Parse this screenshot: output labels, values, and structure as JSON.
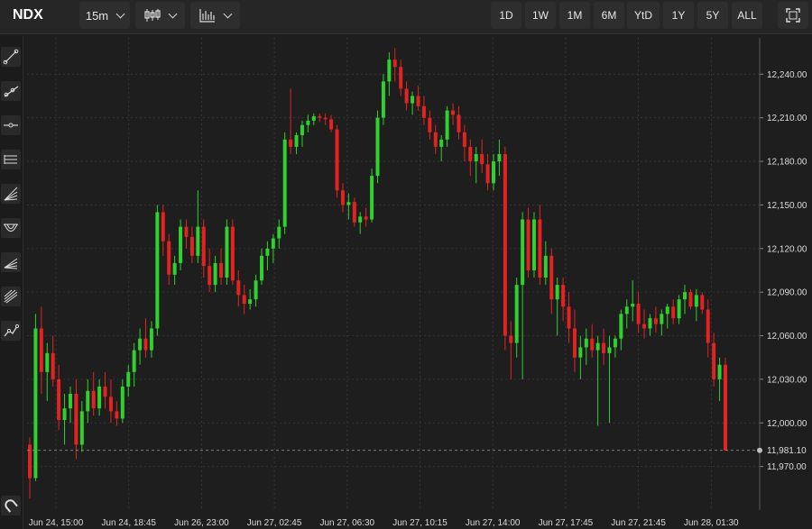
{
  "toolbar": {
    "symbol": "NDX",
    "interval": "15m",
    "chart_type_icon": "candlestick-icon",
    "indicators_icon": "bar-volume-icon",
    "ranges": [
      "1D",
      "1W",
      "1M",
      "6M",
      "YtD",
      "1Y",
      "5Y",
      "ALL"
    ],
    "fullscreen_icon": "fullscreen-icon"
  },
  "left_tools": [
    "trendline-icon",
    "ray-icon",
    "horizontal-line-icon",
    "parallel-channel-icon",
    "fib-fan-icon",
    "fib-arc-icon",
    "pitchfork-icon",
    "gann-icon",
    "path-icon",
    "magnet-icon"
  ],
  "colors": {
    "up": "#2fd12f",
    "down": "#e52222",
    "background": "#1e1e1e",
    "grid": "#3a3a3a"
  },
  "chart_data": {
    "type": "candlestick",
    "symbol": "NDX",
    "interval": "15m",
    "ylim": [
      11940,
      12265
    ],
    "y_ticks": [
      "12,240.00",
      "12,210.00",
      "12,180.00",
      "12,150.00",
      "12,120.00",
      "12,090.00",
      "12,060.00",
      "12,030.00",
      "12,000.00",
      "11,970.00"
    ],
    "y_tick_values": [
      12240,
      12210,
      12180,
      12150,
      12120,
      12090,
      12060,
      12030,
      12000,
      11970
    ],
    "x_ticks": [
      "Jun 24, 15:00",
      "Jun 24, 18:45",
      "Jun 26, 23:00",
      "Jun 27, 02:45",
      "Jun 27, 06:30",
      "Jun 27, 10:15",
      "Jun 27, 14:00",
      "Jun 27, 17:45",
      "Jun 27, 21:45",
      "Jun 28, 01:30"
    ],
    "last_price_label": "11,981.10",
    "last_price": 11981.1,
    "ohlc_note": "approximate per-candle values read from the chart",
    "candles": [
      [
        11985,
        11990,
        11948,
        11962
      ],
      [
        11962,
        12075,
        11960,
        12065
      ],
      [
        12065,
        12080,
        12020,
        12035
      ],
      [
        12035,
        12055,
        12015,
        12048
      ],
      [
        12048,
        12060,
        12025,
        12030
      ],
      [
        12030,
        12040,
        11995,
        12002
      ],
      [
        12002,
        12020,
        11985,
        12010
      ],
      [
        12010,
        12025,
        12000,
        12020
      ],
      [
        12020,
        12030,
        11975,
        11985
      ],
      [
        11985,
        12015,
        11980,
        12008
      ],
      [
        12008,
        12030,
        12000,
        12022
      ],
      [
        12022,
        12035,
        12005,
        12010
      ],
      [
        12010,
        12030,
        12005,
        12025
      ],
      [
        12025,
        12035,
        12010,
        12018
      ],
      [
        12018,
        12030,
        12000,
        12008
      ],
      [
        12008,
        12015,
        11998,
        12003
      ],
      [
        12003,
        12030,
        12000,
        12025
      ],
      [
        12025,
        12040,
        12018,
        12035
      ],
      [
        12035,
        12055,
        12025,
        12050
      ],
      [
        12050,
        12065,
        12040,
        12058
      ],
      [
        12058,
        12072,
        12045,
        12050
      ],
      [
        12050,
        12070,
        12045,
        12065
      ],
      [
        12065,
        12150,
        12060,
        12145
      ],
      [
        12145,
        12150,
        12115,
        12125
      ],
      [
        12125,
        12130,
        12095,
        12102
      ],
      [
        12102,
        12115,
        12095,
        12110
      ],
      [
        12110,
        12140,
        12105,
        12135
      ],
      [
        12135,
        12140,
        12120,
        12128
      ],
      [
        12128,
        12135,
        12110,
        12115
      ],
      [
        12115,
        12160,
        12110,
        12135
      ],
      [
        12135,
        12140,
        12100,
        12108
      ],
      [
        12108,
        12120,
        12090,
        12095
      ],
      [
        12095,
        12115,
        12090,
        12110
      ],
      [
        12110,
        12120,
        12095,
        12100
      ],
      [
        12100,
        12140,
        12095,
        12135
      ],
      [
        12135,
        12140,
        12095,
        12098
      ],
      [
        12098,
        12105,
        12080,
        12088
      ],
      [
        12088,
        12095,
        12075,
        12082
      ],
      [
        12082,
        12092,
        12078,
        12085
      ],
      [
        12085,
        12102,
        12080,
        12098
      ],
      [
        12098,
        12120,
        12095,
        12115
      ],
      [
        12115,
        12125,
        12105,
        12120
      ],
      [
        12120,
        12130,
        12110,
        12127
      ],
      [
        12127,
        12140,
        12120,
        12135
      ],
      [
        12135,
        12200,
        12130,
        12195
      ],
      [
        12195,
        12230,
        12185,
        12190
      ],
      [
        12190,
        12200,
        12185,
        12198
      ],
      [
        12198,
        12208,
        12190,
        12205
      ],
      [
        12205,
        12212,
        12200,
        12208
      ],
      [
        12208,
        12213,
        12205,
        12211
      ],
      [
        12211,
        12213,
        12207,
        12210
      ],
      [
        12210,
        12213,
        12205,
        12209
      ],
      [
        12209,
        12212,
        12200,
        12202
      ],
      [
        12202,
        12205,
        12155,
        12160
      ],
      [
        12160,
        12165,
        12145,
        12150
      ],
      [
        12150,
        12158,
        12140,
        12152
      ],
      [
        12152,
        12155,
        12135,
        12138
      ],
      [
        12138,
        12145,
        12130,
        12142
      ],
      [
        12142,
        12148,
        12135,
        12140
      ],
      [
        12140,
        12175,
        12138,
        12170
      ],
      [
        12170,
        12215,
        12165,
        12210
      ],
      [
        12210,
        12240,
        12205,
        12235
      ],
      [
        12235,
        12255,
        12225,
        12250
      ],
      [
        12250,
        12258,
        12235,
        12245
      ],
      [
        12245,
        12250,
        12225,
        12230
      ],
      [
        12230,
        12235,
        12215,
        12220
      ],
      [
        12220,
        12228,
        12212,
        12225
      ],
      [
        12225,
        12232,
        12215,
        12218
      ],
      [
        12218,
        12225,
        12205,
        12210
      ],
      [
        12210,
        12215,
        12195,
        12200
      ],
      [
        12200,
        12205,
        12185,
        12190
      ],
      [
        12190,
        12198,
        12180,
        12195
      ],
      [
        12195,
        12218,
        12190,
        12215
      ],
      [
        12215,
        12220,
        12205,
        12212
      ],
      [
        12212,
        12218,
        12195,
        12200
      ],
      [
        12200,
        12205,
        12180,
        12190
      ],
      [
        12190,
        12195,
        12170,
        12180
      ],
      [
        12180,
        12190,
        12165,
        12185
      ],
      [
        12185,
        12195,
        12172,
        12178
      ],
      [
        12178,
        12185,
        12160,
        12165
      ],
      [
        12165,
        12185,
        12160,
        12180
      ],
      [
        12180,
        12195,
        12170,
        12185
      ],
      [
        12185,
        12190,
        12050,
        12060
      ],
      [
        12060,
        12070,
        12030,
        12055
      ],
      [
        12055,
        12100,
        12045,
        12095
      ],
      [
        12095,
        12145,
        12030,
        12140
      ],
      [
        12140,
        12148,
        12100,
        12105
      ],
      [
        12105,
        12145,
        12100,
        12140
      ],
      [
        12140,
        12150,
        12095,
        12100
      ],
      [
        12100,
        12125,
        12095,
        12115
      ],
      [
        12115,
        12120,
        12075,
        12085
      ],
      [
        12085,
        12100,
        12060,
        12095
      ],
      [
        12095,
        12100,
        12070,
        12080
      ],
      [
        12080,
        12090,
        12055,
        12065
      ],
      [
        12065,
        12078,
        12035,
        12045
      ],
      [
        12045,
        12060,
        12030,
        12052
      ],
      [
        12052,
        12065,
        12040,
        12058
      ],
      [
        12058,
        12068,
        12045,
        12050
      ],
      [
        12050,
        12060,
        11998,
        12055
      ],
      [
        12055,
        12065,
        12040,
        12048
      ],
      [
        12048,
        12060,
        12000,
        12052
      ],
      [
        12052,
        12060,
        12045,
        12058
      ],
      [
        12058,
        12078,
        12050,
        12075
      ],
      [
        12075,
        12085,
        12065,
        12080
      ],
      [
        12080,
        12098,
        12070,
        12082
      ],
      [
        12082,
        12090,
        12062,
        12068
      ],
      [
        12068,
        12078,
        12058,
        12065
      ],
      [
        12065,
        12075,
        12060,
        12072
      ],
      [
        12072,
        12080,
        12062,
        12068
      ],
      [
        12068,
        12078,
        12060,
        12075
      ],
      [
        12075,
        12082,
        12065,
        12080
      ],
      [
        12080,
        12085,
        12068,
        12072
      ],
      [
        12072,
        12088,
        12068,
        12085
      ],
      [
        12085,
        12095,
        12075,
        12090
      ],
      [
        12090,
        12092,
        12078,
        12080
      ],
      [
        12080,
        12092,
        12070,
        12088
      ],
      [
        12088,
        12090,
        12075,
        12078
      ],
      [
        12078,
        12085,
        12045,
        12055
      ],
      [
        12055,
        12062,
        12025,
        12030
      ],
      [
        12030,
        12045,
        12015,
        12040
      ],
      [
        12040,
        12045,
        11995,
        11981
      ]
    ]
  }
}
